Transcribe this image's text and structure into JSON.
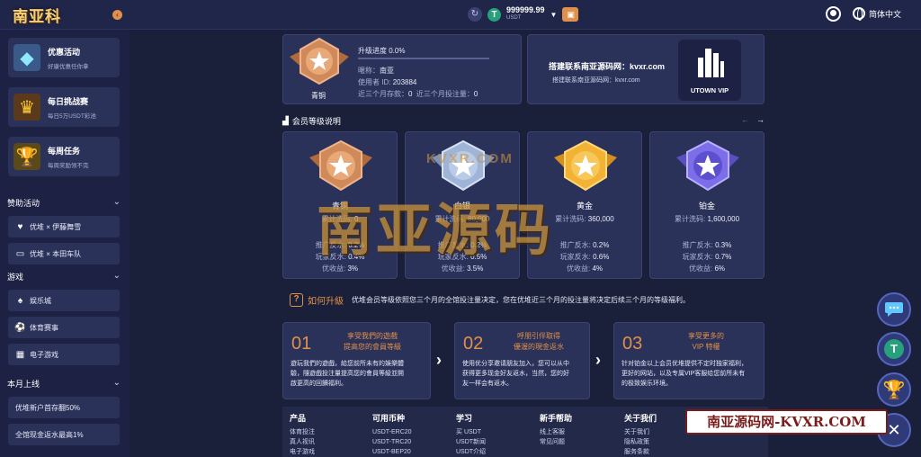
{
  "header": {
    "logo_text": "南亚科技",
    "balance": "999999.99",
    "currency": "USDT",
    "language": "简体中文"
  },
  "sidebar": {
    "promos": [
      {
        "title": "优惠活动",
        "subtitle": "好康优惠任你拿"
      },
      {
        "title": "每日挑战赛",
        "subtitle": "每日5万USDT彩池"
      },
      {
        "title": "每周任务",
        "subtitle": "每周奖励领不完"
      }
    ],
    "sections": {
      "sponsor": {
        "title": "赞助活动",
        "items": [
          "优堆 × 伊藤舞雪",
          "优堆 × 本田车队"
        ]
      },
      "games": {
        "title": "游戏",
        "items": [
          "娱乐城",
          "体育赛事",
          "电子游戏"
        ]
      },
      "monthly": {
        "title": "本月上线",
        "items": [
          "优堆新户首存翻50%",
          "全馆现金返水最高1%"
        ]
      }
    }
  },
  "profile": {
    "rank": "青铜",
    "progress_label": "升级进度 0.0%",
    "progress_pct": 0,
    "nickname_label": "暱称：",
    "nickname": "南亚",
    "userid_label": "使用者 ID:",
    "userid": "203884",
    "deposit_label": "近三个月存款：",
    "deposit_value": "0",
    "bet_label": "近三个月投注量：",
    "bet_value": "0"
  },
  "vip_banner": {
    "title": "搭建联系南亚源码网：kvxr.com",
    "subtitle": "搭建联系南亚源码网：kvxr.com",
    "logo_label": "UTOWN VIP"
  },
  "member_levels": {
    "title": "会员等级说明",
    "tiers": [
      {
        "name": "青铜",
        "score_label": "累计洗码:",
        "score": "0",
        "promo_label": "推广反水:",
        "promo": "0.2%",
        "player_label": "玩家反水:",
        "player": "0.4%",
        "bonus_label": "优收益:",
        "bonus": "3%",
        "color": "#d08a5a"
      },
      {
        "name": "白银",
        "score_label": "累计洗码:",
        "score": "80,000",
        "promo_label": "推广反水:",
        "promo": "0.2%",
        "player_label": "玩家反水:",
        "player": "0.5%",
        "bonus_label": "优收益:",
        "bonus": "3.5%",
        "color": "#9fb4d6"
      },
      {
        "name": "黄金",
        "score_label": "累计洗码:",
        "score": "360,000",
        "promo_label": "推广反水:",
        "promo": "0.2%",
        "player_label": "玩家反水:",
        "player": "0.6%",
        "bonus_label": "优收益:",
        "bonus": "4%",
        "color": "#f2b233"
      },
      {
        "name": "铂金",
        "score_label": "累计洗码:",
        "score": "1,600,000",
        "promo_label": "推广反水:",
        "promo": "0.3%",
        "player_label": "玩家反水:",
        "player": "0.7%",
        "bonus_label": "优收益:",
        "bonus": "6%",
        "color": "#7b6ee8"
      }
    ]
  },
  "how_to": {
    "title": "如何升級",
    "description": "优堆会员等级依照您三个月的全馆投注量决定，您在优堆近三个月的投注量将决定后续三个月的等级福利。"
  },
  "steps": [
    {
      "num": "01",
      "title1": "享受我們的遊戲",
      "title2": "提高您的會員等級",
      "desc": [
        "遊玩我們的遊戲，給您前所未有的娛樂體",
        "驗，隨遊戲投注量提高您的會員等級並開",
        "啟更高的回饋福利。"
      ]
    },
    {
      "num": "02",
      "title1": "呼朋引伴取得",
      "title2": "優渥的現金返水",
      "desc": [
        "使用优分享邀请朋友加入，您可以从中",
        "获得更多现金好友返水，当然，您的好",
        "友一样会有返水。"
      ]
    },
    {
      "num": "03",
      "title1": "享受更多的",
      "title2": "VIP 特權",
      "desc": [
        "针对铂金以上会员优堆提供不定时独家福利，",
        "更好的网站，以及专属VIP客服给您前所未有",
        "的极致娱乐环境。"
      ]
    }
  ],
  "footer": {
    "columns": [
      {
        "title": "产品",
        "links": [
          "体育投注",
          "真人视讯",
          "电子游戏"
        ]
      },
      {
        "title": "可用币种",
        "links": [
          "USDT-ERC20",
          "USDT-TRC20",
          "USDT-BEP20"
        ]
      },
      {
        "title": "学习",
        "links": [
          "买 USDT",
          "USDT新闻",
          "USDT介绍"
        ]
      },
      {
        "title": "新手帮助",
        "links": [
          "线上客服",
          "常见问题"
        ]
      },
      {
        "title": "关于我们",
        "links": [
          "关于我们",
          "隐私政策",
          "服务条款"
        ]
      }
    ]
  },
  "watermark": {
    "big": "南亚源码",
    "small": "KVXR.COM",
    "banner": "南亚源码网-KVXR.COM"
  },
  "colors": {
    "bg": "#1a1f3a",
    "panel": "#2b325a",
    "accent": "#e0904a",
    "usdt": "#26a17b"
  }
}
